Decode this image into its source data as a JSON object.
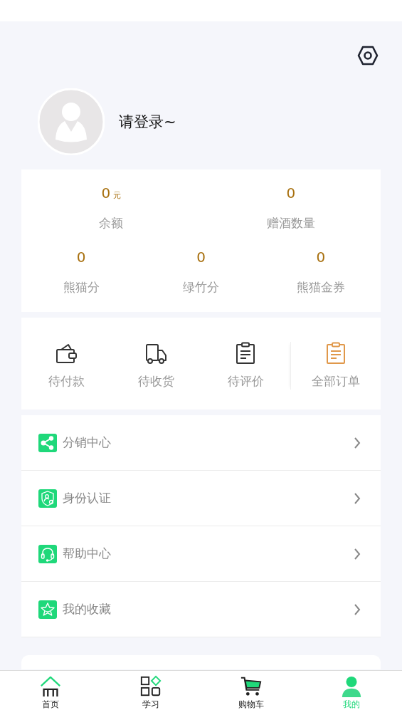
{
  "profile": {
    "login_prompt": "请登录~"
  },
  "stats": [
    [
      {
        "value": "0",
        "unit": "元",
        "label": "余额"
      },
      {
        "value": "0",
        "label": "赠酒数量"
      }
    ],
    [
      {
        "value": "0",
        "label": "熊猫分"
      },
      {
        "value": "0",
        "label": "绿竹分"
      },
      {
        "value": "0",
        "label": "熊猫金券"
      }
    ]
  ],
  "orders": [
    {
      "kind": "wallet",
      "label": "待付款"
    },
    {
      "kind": "truck",
      "label": "待收货"
    },
    {
      "kind": "clipboard",
      "label": "待评价"
    },
    {
      "kind": "all",
      "label": "全部订单"
    }
  ],
  "menu": [
    {
      "kind": "share",
      "label": "分销中心"
    },
    {
      "kind": "shield",
      "label": "身份认证"
    },
    {
      "kind": "headset",
      "label": "帮助中心"
    },
    {
      "kind": "star",
      "label": "我的收藏"
    }
  ],
  "tabs": [
    {
      "kind": "home",
      "label": "首页",
      "selected": false
    },
    {
      "kind": "grid",
      "label": "学习",
      "selected": false
    },
    {
      "kind": "cart",
      "label": "购物车",
      "selected": false
    },
    {
      "kind": "user",
      "label": "我的",
      "selected": true
    }
  ]
}
